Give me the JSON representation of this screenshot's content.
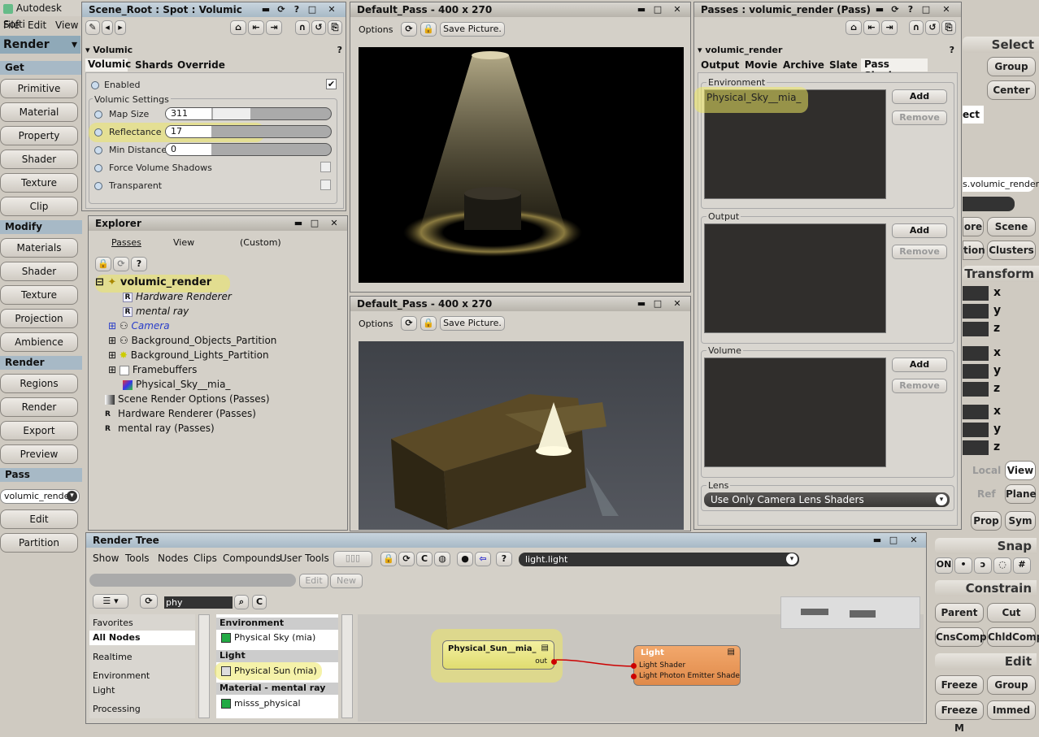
{
  "app": {
    "title": "Autodesk Softi",
    "menu": [
      "File",
      "Edit",
      "View"
    ],
    "render_header": "Render"
  },
  "left": {
    "sections": [
      "Get",
      "Modify",
      "Render",
      "Pass"
    ],
    "get": [
      "Primitive",
      "Material",
      "Property",
      "Shader",
      "Texture",
      "Clip"
    ],
    "modify": [
      "Materials",
      "Shader",
      "Texture",
      "Projection",
      "Ambience"
    ],
    "render": [
      "Regions",
      "Render",
      "Export",
      "Preview"
    ],
    "pass_select": "volumic_rende",
    "pass": [
      "Edit",
      "Partition"
    ]
  },
  "ppg": {
    "title": "Scene_Root : Spot : Volumic",
    "section": "Volumic",
    "tabs": [
      "Volumic",
      "Shards",
      "Override"
    ],
    "enabled_label": "Enabled",
    "settings_title": "Volumic Settings",
    "params": [
      {
        "label": "Map Size",
        "value": "311"
      },
      {
        "label": "Reflectance",
        "value": "17"
      },
      {
        "label": "Min Distance",
        "value": "0"
      }
    ],
    "force_label": "Force Volume Shadows",
    "transparent_label": "Transparent"
  },
  "explorer": {
    "title": "Explorer",
    "menus": [
      "Passes",
      "View",
      "(Custom)"
    ],
    "items": [
      "volumic_render",
      "Hardware Renderer",
      "mental ray",
      "Camera",
      "Background_Objects_Partition",
      "Background_Lights_Partition",
      "Framebuffers",
      "Physical_Sky__mia_",
      "Scene Render Options (Passes)",
      "Hardware Renderer (Passes)",
      "mental ray (Passes)"
    ]
  },
  "viewer1": {
    "title": "Default_Pass -  400 x 270",
    "options": "Options",
    "save": "Save Picture."
  },
  "viewer2": {
    "title": "Default_Pass -  400 x 270",
    "options": "Options",
    "save": "Save Picture."
  },
  "passes": {
    "title": "Passes : volumic_render (Pass)",
    "section": "volumic_render",
    "tabs": [
      "Output",
      "Movie",
      "Archive",
      "Slate",
      "Pass Shaders"
    ],
    "env_label": "Environment",
    "env_item": "Physical_Sky__mia_",
    "output_label": "Output",
    "volume_label": "Volume",
    "add": "Add",
    "remove": "Remove",
    "lens_label": "Lens",
    "lens_value": "Use Only Camera Lens Shaders"
  },
  "right": {
    "select": "Select",
    "group": "Group",
    "center": "Center",
    "ect": "ect",
    "pass_field": "s.volumic_render",
    "ore": "ore",
    "scene": "Scene",
    "tion": "tion",
    "clusters": "Clusters",
    "transform": "Transform",
    "local": "Local",
    "view": "View",
    "ref": "Ref",
    "plane": "Plane",
    "prop": "Prop",
    "sym": "Sym",
    "snap": "Snap",
    "on": "ON",
    "constrain": "Constrain",
    "parent": "Parent",
    "cut": "Cut",
    "cnscomp": "CnsComp",
    "chldcomp": "ChldComp",
    "edit": "Edit",
    "freeze": "Freeze",
    "group2": "Group",
    "freezem": "Freeze M",
    "immed": "Immed",
    "axes": [
      "x",
      "y",
      "z",
      "x",
      "y",
      "z",
      "x",
      "y",
      "z"
    ]
  },
  "render_tree": {
    "title": "Render Tree",
    "menus": [
      "Show",
      "Tools",
      "Nodes",
      "Clips",
      "Compounds",
      "User Tools"
    ],
    "node_field": "light.light",
    "edit": "Edit",
    "new": "New",
    "search": "phy",
    "categories": [
      "Favorites",
      "All Nodes",
      "Realtime",
      "Environment",
      "Light",
      "Processing"
    ],
    "groups": [
      "Environment",
      "Light",
      "Material - mental ray"
    ],
    "nodes": [
      "Physical Sky (mia)",
      "Physical Sun (mia)",
      "misss_physical"
    ],
    "sun_node": "Physical_Sun__mia_",
    "sun_port": "out",
    "light_node": "Light",
    "light_ports": [
      "Light Shader",
      "Light Photon Emitter Shade"
    ]
  }
}
